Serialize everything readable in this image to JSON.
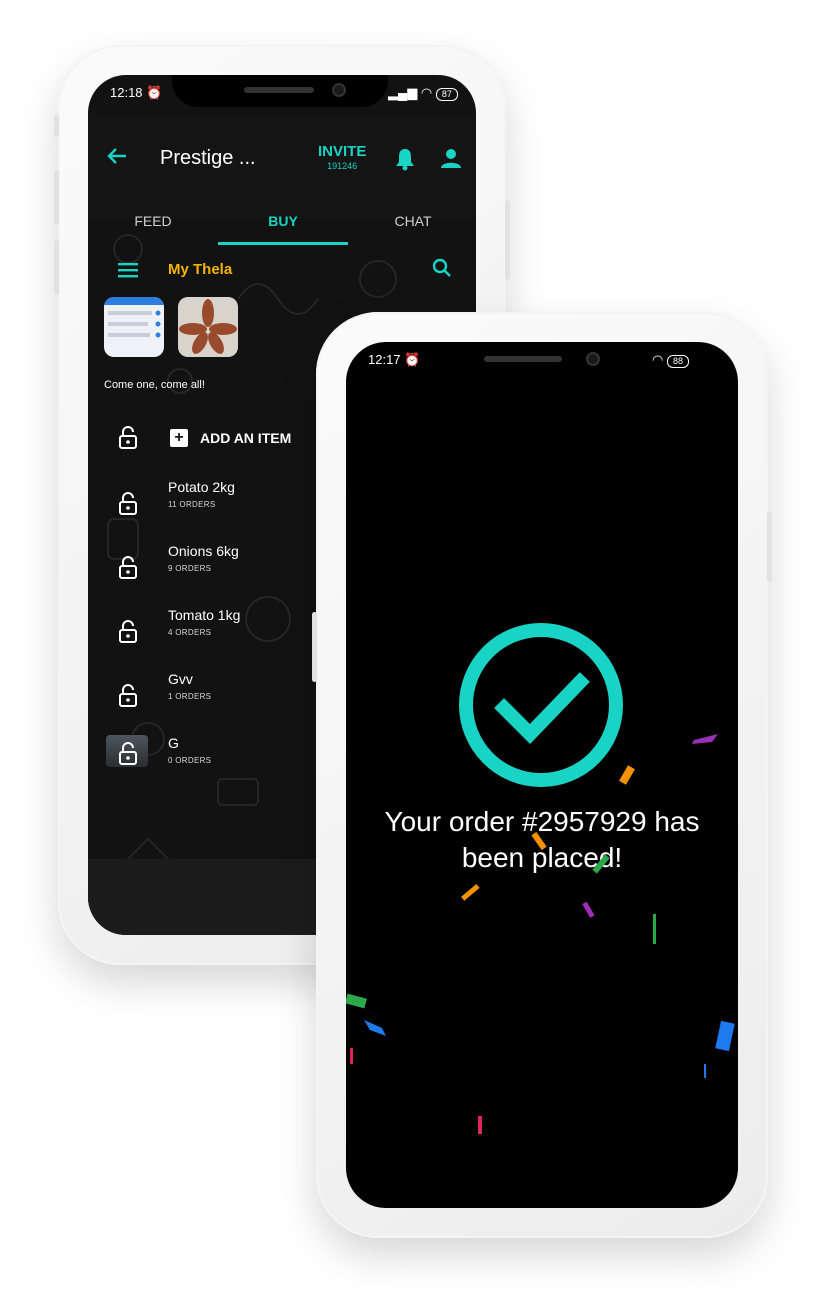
{
  "back_phone": {
    "status": {
      "time": "12:18",
      "battery": "87"
    },
    "header": {
      "title": "Prestige ...",
      "invite_label": "INVITE",
      "invite_code": "191246"
    },
    "tabs": [
      {
        "label": "FEED"
      },
      {
        "label": "BUY",
        "active": true
      },
      {
        "label": "CHAT"
      }
    ],
    "shop": {
      "name": "My Thela",
      "tagline": "Come one, come all!"
    },
    "add_item_label": "ADD AN ITEM",
    "items": [
      {
        "name": "Potato 2kg",
        "orders": "11 ORDERS"
      },
      {
        "name": "Onions 6kg",
        "orders": "9 ORDERS"
      },
      {
        "name": "Tomato 1kg",
        "orders": "4 ORDERS"
      },
      {
        "name": "Gvv",
        "orders": "1 ORDERS"
      },
      {
        "name": "G",
        "orders": "0 ORDERS"
      }
    ]
  },
  "front_phone": {
    "status": {
      "time": "12:17",
      "battery": "88"
    },
    "confirmation": {
      "line1": "Your order #2957929 has",
      "line2": "been placed!"
    }
  },
  "colors": {
    "accent": "#19d3c5",
    "shop_name": "#f5b400",
    "confetti": [
      "#9b2fb5",
      "#f39200",
      "#2aa84a",
      "#1e7bef",
      "#e0245e"
    ]
  },
  "icons": [
    "back-arrow-icon",
    "bell-icon",
    "person-icon",
    "menu-icon",
    "search-icon",
    "lock-icon",
    "plus-icon",
    "checkmark-circle-icon",
    "wifi-icon",
    "signal-icon",
    "alarm-icon"
  ]
}
